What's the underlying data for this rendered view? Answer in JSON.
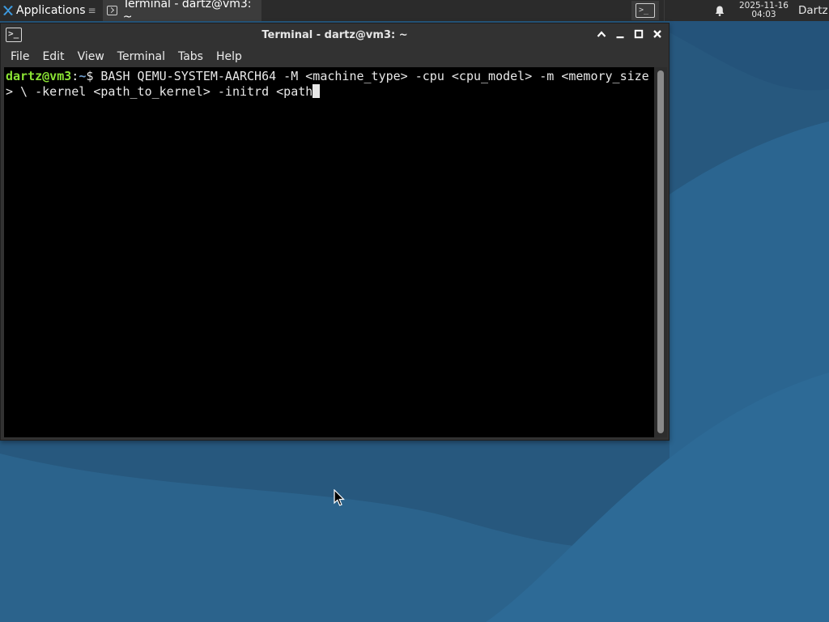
{
  "panel": {
    "apps_label": "Applications",
    "apps_trail": "≡",
    "task_title": "Terminal - dartz@vm3: ~",
    "clock_date": "2025-11-16",
    "clock_time": "04:03",
    "user": "Dartz",
    "icons": [
      "applications-logo-icon",
      "terminal-icon",
      "workspace-terminal-icon",
      "bell-icon"
    ]
  },
  "window": {
    "title": "Terminal - dartz@vm3: ~",
    "controls": [
      "restore-up",
      "minimize",
      "maximize",
      "close"
    ],
    "menu": [
      "File",
      "Edit",
      "View",
      "Terminal",
      "Tabs",
      "Help"
    ]
  },
  "terminal": {
    "prompt_user": "dartz@vm3",
    "prompt_sep": ":",
    "prompt_path": "~",
    "prompt_sign": "$ ",
    "command": "BASH QEMU-SYSTEM-AARCH64 -M <machine_type> -cpu <cpu_model> -m <memory_size> \\ -kernel <path_to_kernel> -initrd <path"
  },
  "colors": {
    "panel_bg": "#2b2b2b",
    "window_bg": "#323232",
    "terminal_bg": "#000000",
    "prompt_user": "#8ae234",
    "prompt_path": "#729fcf",
    "desktop": "#27587e"
  }
}
